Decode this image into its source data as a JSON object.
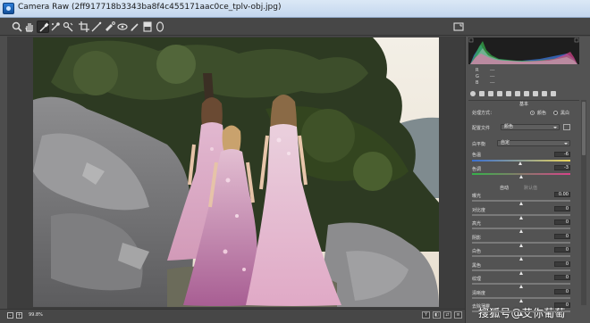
{
  "window": {
    "title": "Camera Raw (2ff917718b3343ba8f4c455171aac0ce_tplv-obj.jpg)"
  },
  "toolbar": {
    "tools": [
      "zoom-icon",
      "hand-icon",
      "white-balance-icon",
      "color-sampler-icon",
      "targeted-adjust-icon",
      "crop-icon",
      "straighten-icon",
      "spot-removal-icon",
      "red-eye-icon",
      "adjustment-brush-icon",
      "graduated-filter-icon",
      "radial-filter-icon"
    ],
    "active_tool": "white-balance-icon"
  },
  "histogram": {
    "readout": [
      {
        "key": "R",
        "value": "---"
      },
      {
        "key": "G",
        "value": "---"
      },
      {
        "key": "B",
        "value": "---"
      }
    ]
  },
  "panel": {
    "section_title": "基本",
    "treatment_label": "处理方式：",
    "treatment_options": [
      "颜色",
      "黑白"
    ],
    "treatment_selected": "颜色",
    "profile_label": "配置文件",
    "profile_value": "颜色",
    "wb_label": "白平衡",
    "wb_value": "自定",
    "temp_label": "色温",
    "temp_value": "-6",
    "tint_label": "色调",
    "tint_value": "-3",
    "auto_label": "自动",
    "default_label": "默认值",
    "sliders": [
      {
        "label": "曝光",
        "value": "0.00"
      },
      {
        "label": "对比度",
        "value": "0"
      },
      {
        "label": "高光",
        "value": "0"
      },
      {
        "label": "阴影",
        "value": "0"
      },
      {
        "label": "白色",
        "value": "0"
      },
      {
        "label": "黑色",
        "value": "0"
      },
      {
        "label": "纹理",
        "value": "0"
      },
      {
        "label": "清晰度",
        "value": "0"
      },
      {
        "label": "去除薄雾",
        "value": "0"
      }
    ]
  },
  "bottombar": {
    "zoom": "99.8%"
  },
  "watermark": "搜狐号@艾你葡萄",
  "colors": {
    "panel_bg": "#535353",
    "title_bg": "#dbe8f6",
    "pink_dress": "#d99cc0",
    "mauve_dress": "#b06a9a"
  }
}
